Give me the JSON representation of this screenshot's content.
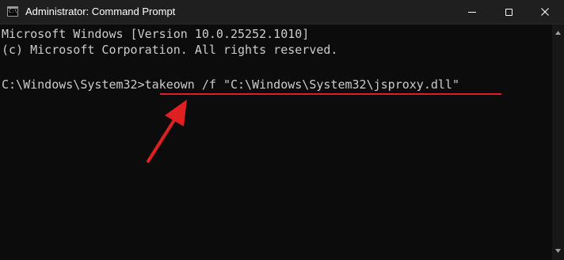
{
  "window": {
    "title": "Administrator: Command Prompt",
    "icon_label": "C:\\."
  },
  "controls": {
    "minimize": "minimize-icon",
    "maximize": "maximize-icon",
    "close": "close-icon"
  },
  "console": {
    "line1": "Microsoft Windows [Version 10.0.25252.1010]",
    "line2": "(c) Microsoft Corporation. All rights reserved.",
    "prompt": "C:\\Windows\\System32>",
    "command": "takeown /f \"C:\\Windows\\System32\\jsproxy.dll\""
  },
  "annotation": {
    "color": "#e02020"
  }
}
